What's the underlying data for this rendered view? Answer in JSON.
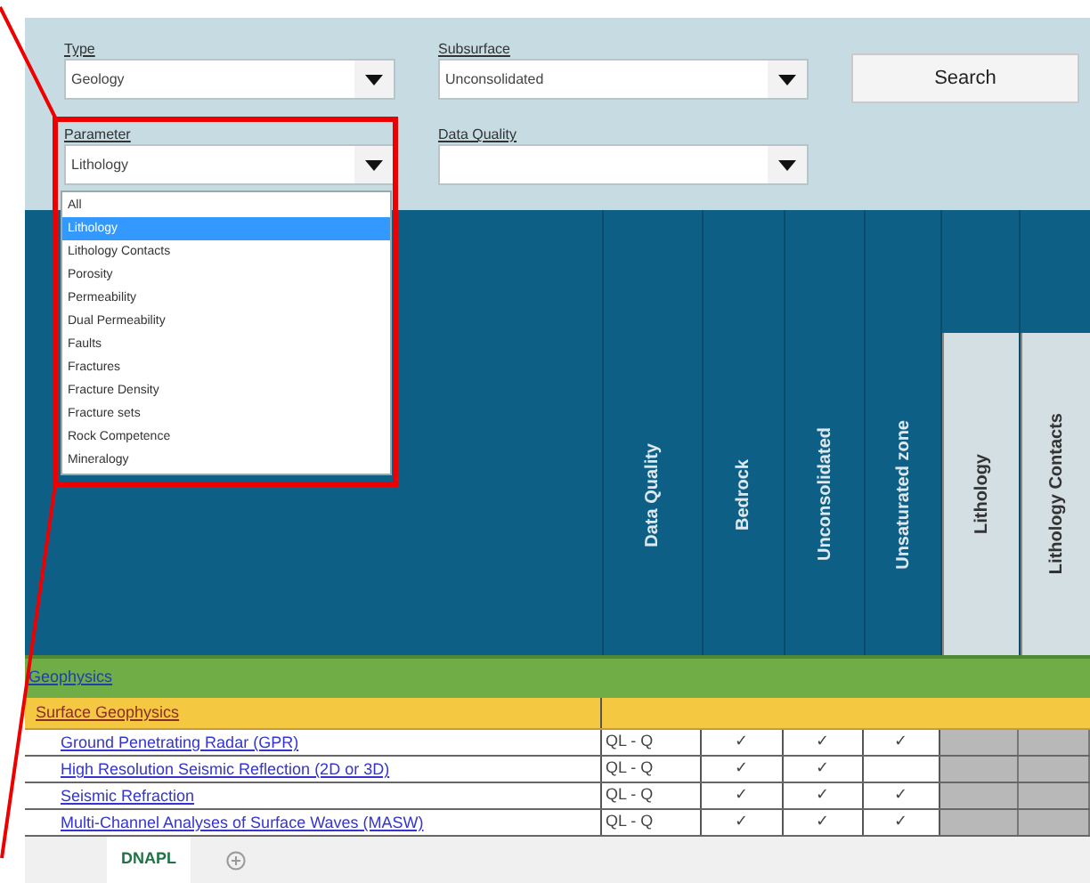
{
  "filters": [
    {
      "label": "Type",
      "value": "Geology"
    },
    {
      "label": "Subsurface",
      "value": "Unconsolidated"
    },
    {
      "label": "Parameter",
      "value": "Lithology"
    },
    {
      "label": "Data Quality"
    }
  ],
  "search_button": "Search",
  "parameter_options": [
    {
      "label": "All",
      "selected": false
    },
    {
      "label": "Lithology",
      "selected": true
    },
    {
      "label": "Lithology Contacts",
      "selected": false
    },
    {
      "label": "Porosity",
      "selected": false
    },
    {
      "label": "Permeability",
      "selected": false
    },
    {
      "label": "Dual Permeability",
      "selected": false
    },
    {
      "label": "Faults",
      "selected": false
    },
    {
      "label": "Fractures",
      "selected": false
    },
    {
      "label": "Fracture Density",
      "selected": false
    },
    {
      "label": "Fracture sets",
      "selected": false
    },
    {
      "label": "Rock Competence",
      "selected": false
    },
    {
      "label": "Mineralogy",
      "selected": false
    }
  ],
  "columns": [
    {
      "label": "Data Quality",
      "kind": "criterion"
    },
    {
      "label": "Bedrock",
      "kind": "criterion"
    },
    {
      "label": "Unconsolidated",
      "kind": "criterion"
    },
    {
      "label": "Unsaturated zone",
      "kind": "criterion"
    },
    {
      "label": "Lithology",
      "kind": "parameter"
    },
    {
      "label": "Lithology Contacts",
      "kind": "parameter"
    }
  ],
  "group": "Geophysics",
  "subgroup": "Surface Geophysics",
  "rows": [
    {
      "method": "Ground Penetrating Radar (GPR)",
      "cells": [
        "QL - Q",
        "✓",
        "✓",
        "✓",
        "",
        ""
      ]
    },
    {
      "method": "High Resolution Seismic Reflection (2D or 3D)",
      "cells": [
        "QL - Q",
        "✓",
        "✓",
        "",
        "",
        ""
      ]
    },
    {
      "method": "Seismic Refraction",
      "cells": [
        "QL - Q",
        "✓",
        "✓",
        "✓",
        "",
        ""
      ]
    },
    {
      "method": "Multi-Channel Analyses of Surface Waves (MASW)",
      "cells": [
        "QL - Q",
        "✓",
        "✓",
        "✓",
        "",
        ""
      ]
    }
  ],
  "sheet_tabs": [
    {
      "label": "DNAPL",
      "selected": true
    }
  ]
}
